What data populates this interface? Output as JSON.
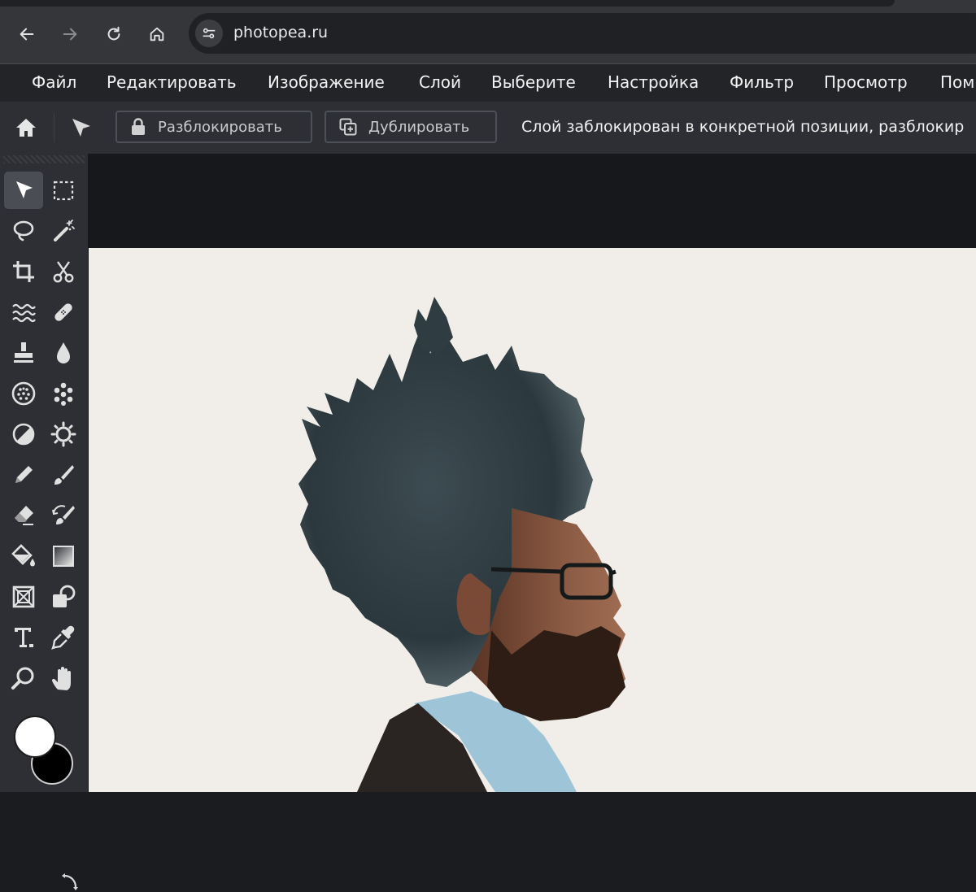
{
  "browser": {
    "url": "photopea.ru",
    "buttons": [
      "back",
      "forward",
      "reload",
      "home"
    ]
  },
  "menu": {
    "items": [
      "Файл",
      "Редактировать",
      "Изображение",
      "Слой",
      "Выберите",
      "Настройка",
      "Фильтр",
      "Просмотр",
      "Пом"
    ]
  },
  "options": {
    "unlock_label": "Разблокировать",
    "duplicate_label": "Дублировать",
    "message": "Слой заблокирован в конкретной позиции, разблокир"
  },
  "toolbox": {
    "tools": [
      "move-tool",
      "marquee-tool",
      "lasso-tool",
      "magic-wand-tool",
      "crop-tool",
      "scissors-tool",
      "liquify-tool",
      "healing-tool",
      "stamp-tool",
      "blur-tool",
      "sponge-tool",
      "pattern-tool",
      "dodge-tool",
      "sharpen-tool",
      "pencil-tool",
      "brush-tool",
      "eraser-tool",
      "history-brush-tool",
      "paint-bucket-tool",
      "gradient-tool",
      "frame-tool",
      "shape-tool",
      "type-tool",
      "eyedropper-tool",
      "zoom-tool",
      "hand-tool"
    ],
    "active_tool": "move-tool",
    "foreground_color": "#ffffff",
    "background_color": "#000000"
  },
  "colors": {
    "chrome": "#35363a",
    "menubar": "#232428",
    "panel": "#2d2f34",
    "canvas_bg": "#f1eee9"
  }
}
